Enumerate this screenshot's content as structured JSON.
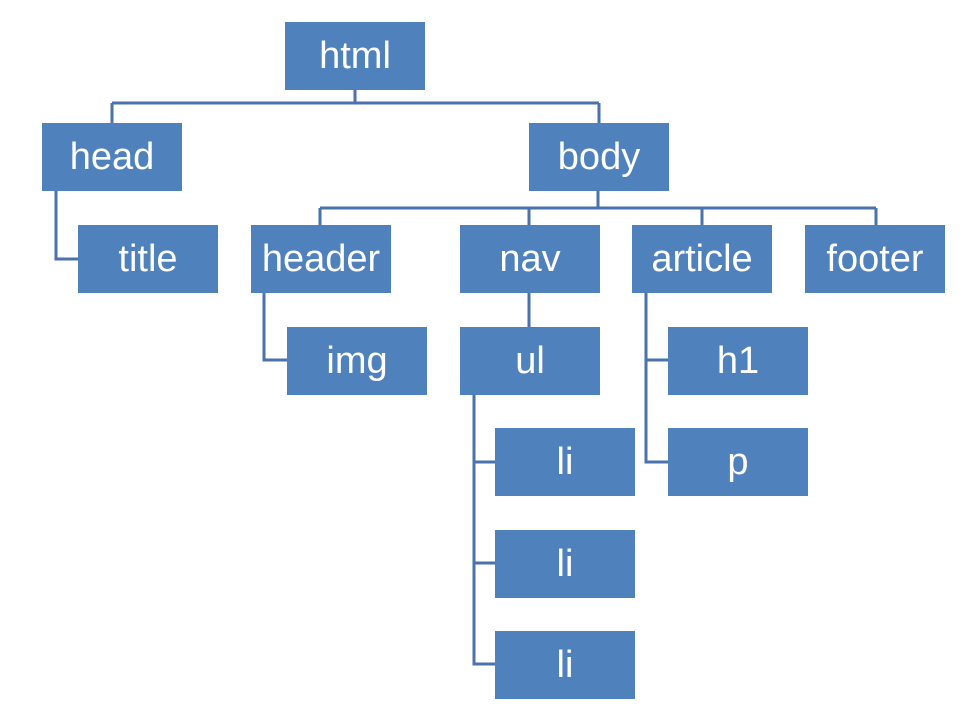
{
  "nodes": {
    "html": "html",
    "head": "head",
    "body": "body",
    "title": "title",
    "header": "header",
    "nav": "nav",
    "article": "article",
    "footer": "footer",
    "img": "img",
    "ul": "ul",
    "li1": "li",
    "li2": "li",
    "li3": "li",
    "h1": "h1",
    "p": "p"
  },
  "colors": {
    "node_fill": "#4f81bd",
    "connector": "#4a72ad",
    "text": "#ffffff"
  }
}
